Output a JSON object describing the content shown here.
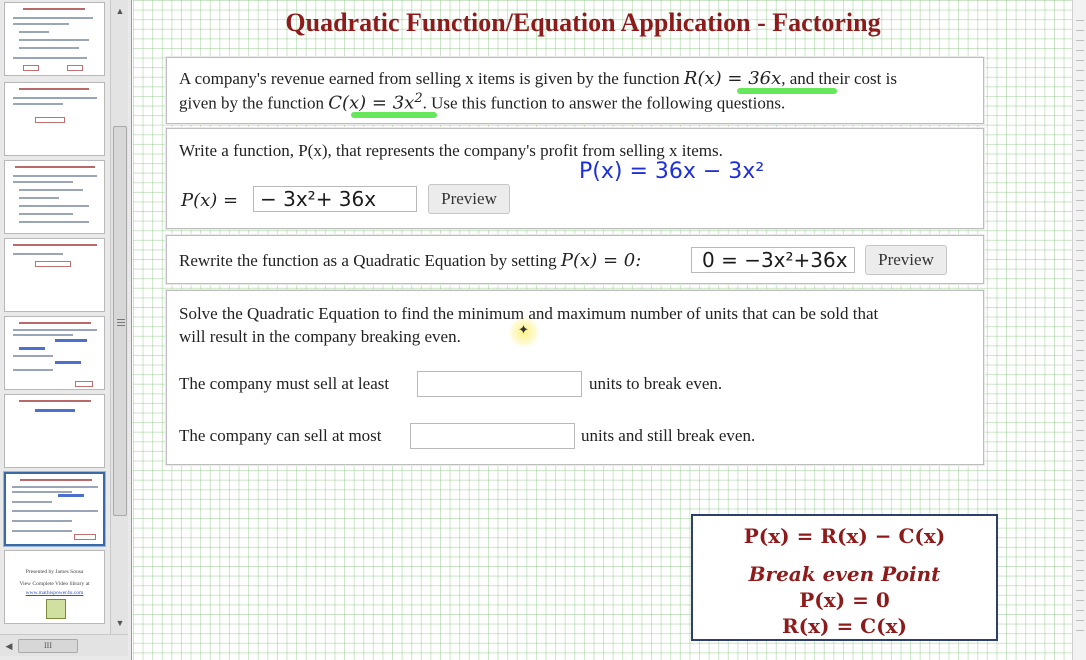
{
  "sidebar": {
    "presented_by": "Presented by James Sousa",
    "view_library": "View Complete Video library at",
    "library_link": "www.mathispower4u.com",
    "scroll_up": "▲",
    "scroll_down": "▼",
    "scroll_left": "◀",
    "hscroll_grip": "III"
  },
  "slide": {
    "title": "Quadratic Function/Equation Application - Factoring",
    "problem": {
      "line1_a": "A company's revenue earned from selling x items is given by the function ",
      "revenue_func": "R(x) = 36x",
      "line1_b": ", and their cost is",
      "line2_a": "given by the function ",
      "cost_func": "C(x) = 3x",
      "cost_exp": "2",
      "line2_b": ". Use this function to answer the following questions."
    },
    "q1": {
      "prompt": "Write a function, P(x), that represents the company's profit from selling x items.",
      "label": "P(x) =",
      "input_value": "− 3x²+ 36x",
      "preview": "Preview",
      "handwritten": "P(x) = 36x − 3x²"
    },
    "q2": {
      "prompt": "Rewrite the function as a Quadratic Equation by setting ",
      "prompt_math": "P(x) = 0:",
      "input_value": "0 = −3x²+36x",
      "preview": "Preview"
    },
    "q3": {
      "prompt_line1": "Solve the Quadratic Equation to find the minimum and maximum number of units that can be sold that",
      "prompt_line2": "will result in the company breaking even.",
      "least_label": "The company must sell at least",
      "least_suffix": "units to break even.",
      "least_value": "",
      "most_label": "The company can sell at most",
      "most_suffix": "units and still break even.",
      "most_value": ""
    },
    "formulas": {
      "profit": "P(x) = R(x) − C(x)",
      "heading": "Break even Point",
      "p_zero": "P(x) = 0",
      "r_equals_c": "R(x) = C(x)"
    }
  },
  "colors": {
    "title": "#8e1b1b",
    "grid": "#78be6e",
    "highlight": "#57e64a",
    "handwriting_blue": "#1f2fd8",
    "formula_border": "#2f3f6b"
  }
}
